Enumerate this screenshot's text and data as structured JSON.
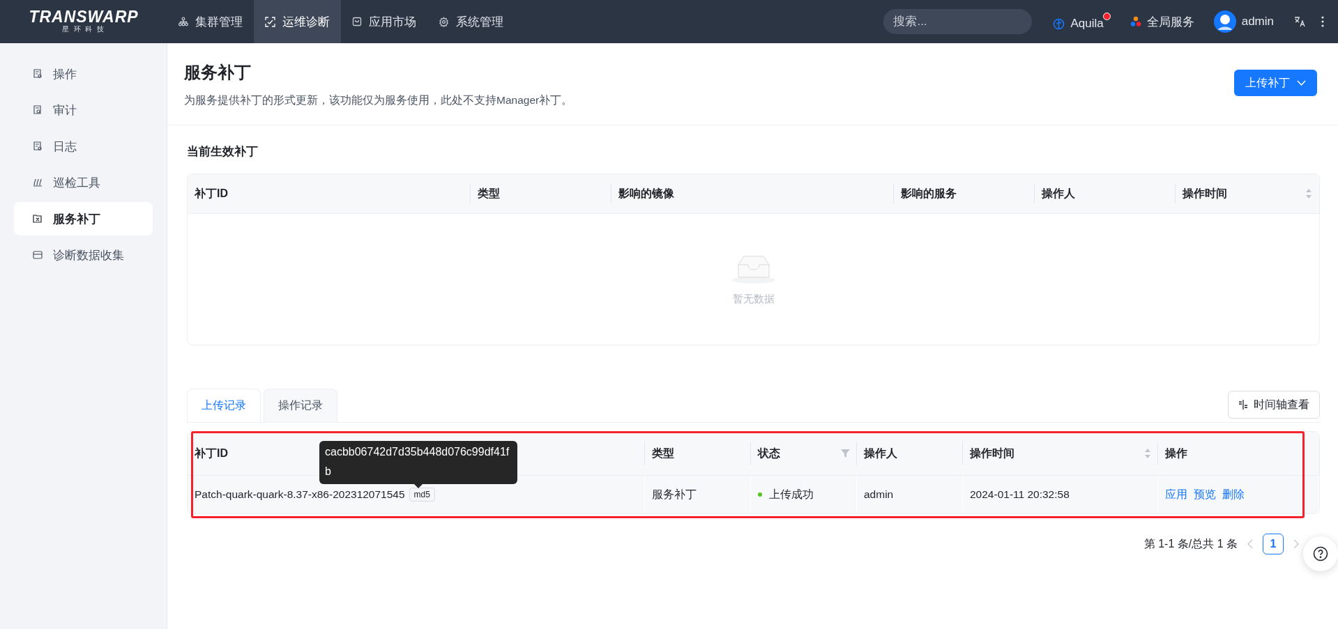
{
  "header": {
    "logo": {
      "wordmark": "TRANSWARP",
      "tagline": "星 环 科 技"
    },
    "nav": [
      {
        "label": "集群管理",
        "selected": false
      },
      {
        "label": "运维诊断",
        "selected": true
      },
      {
        "label": "应用市场",
        "selected": false
      },
      {
        "label": "系统管理",
        "selected": false
      }
    ],
    "search": {
      "placeholder": "搜索..."
    },
    "aquila": {
      "label": "Aquila",
      "has_notification": true
    },
    "global_services": {
      "label": "全局服务"
    },
    "user": {
      "name": "admin"
    }
  },
  "sidebar": {
    "items": [
      {
        "label": "操作",
        "selected": false
      },
      {
        "label": "审计",
        "selected": false
      },
      {
        "label": "日志",
        "selected": false
      },
      {
        "label": "巡检工具",
        "selected": false
      },
      {
        "label": "服务补丁",
        "selected": true
      },
      {
        "label": "诊断数据收集",
        "selected": false
      }
    ]
  },
  "page": {
    "title": "服务补丁",
    "description": "为服务提供补丁的形式更新，该功能仅为服务使用，此处不支持Manager补丁。",
    "upload_button": "上传补丁"
  },
  "current_patches": {
    "title": "当前生效补丁",
    "columns": [
      {
        "label": "补丁ID",
        "kind": "plain"
      },
      {
        "label": "类型",
        "kind": "plain"
      },
      {
        "label": "影响的镜像",
        "kind": "plain"
      },
      {
        "label": "影响的服务",
        "kind": "plain"
      },
      {
        "label": "操作人",
        "kind": "plain"
      },
      {
        "label": "操作时间",
        "kind": "sort"
      }
    ],
    "empty_text": "暂无数据"
  },
  "records": {
    "tabs": [
      {
        "label": "上传记录",
        "selected": true
      },
      {
        "label": "操作记录",
        "selected": false
      }
    ],
    "timeline_button": "时间轴查看",
    "columns": [
      {
        "label": "补丁ID",
        "kind": "plain"
      },
      {
        "label": "类型",
        "kind": "plain"
      },
      {
        "label": "状态",
        "kind": "filter"
      },
      {
        "label": "操作人",
        "kind": "plain"
      },
      {
        "label": "操作时间",
        "kind": "sort"
      },
      {
        "label": "操作",
        "kind": "plain"
      }
    ],
    "rows": [
      {
        "patch_id": "Patch-quark-quark-8.37-x86-202312071545",
        "tag": "md5",
        "type": "服务补丁",
        "status": {
          "text": "上传成功",
          "color": "#52c41a"
        },
        "operator": "admin",
        "time": "2024-01-11 20:32:58",
        "actions": [
          "应用",
          "预览",
          "删除"
        ]
      }
    ],
    "tooltip": "cacbb06742d7d35b448d076c99df41fb",
    "highlighted": true,
    "pagination": {
      "summary": "第 1-1 条/总共 1 条",
      "pages": [
        {
          "label": "1",
          "selected": true
        }
      ]
    }
  }
}
